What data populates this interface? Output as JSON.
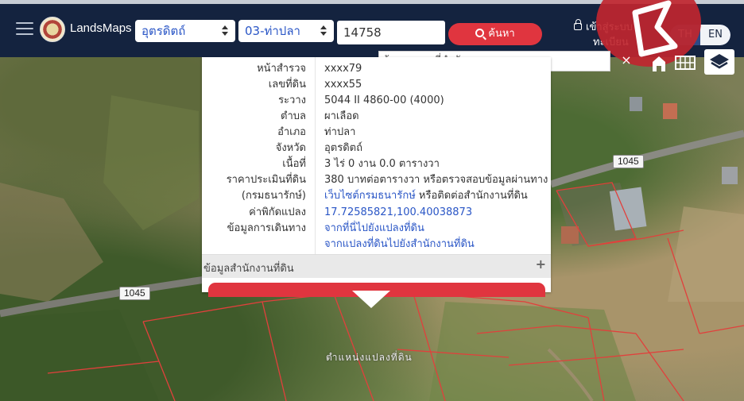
{
  "header": {
    "brand": "LandsMaps",
    "province": "อุตรดิตถ์",
    "district": "03-ท่าปลา",
    "deed_no": "14758",
    "search_label": "ค้นหา",
    "login_line1": "เข้าสู่ระบบ",
    "login_line2": "ทะเบียน",
    "lang_th": "TH",
    "lang_en": "EN"
  },
  "map": {
    "landmark_search_placeholder": "ค้นหาสถานที่สำคัญ",
    "clear": "×",
    "road_badges": [
      "1045",
      "1045"
    ],
    "parcel_label": "ตำแหน่งแปลงที่ดิน"
  },
  "popup": {
    "rows": [
      {
        "label": "หน้าสำรวจ",
        "value": "xxxx79"
      },
      {
        "label": "เลขที่ดิน",
        "value": "xxxx55"
      },
      {
        "label": "ระวาง",
        "value": "5044 II 4860-00 (4000)"
      },
      {
        "label": "ตำบล",
        "value": "ผาเลือด"
      },
      {
        "label": "อำเภอ",
        "value": "ท่าปลา"
      },
      {
        "label": "จังหวัด",
        "value": "อุตรดิตถ์"
      },
      {
        "label": "เนื้อที่",
        "value": "3 ไร่ 0 งาน 0.0 ตารางวา"
      },
      {
        "label": "ราคาประเมินที่ดิน",
        "value": "380 บาทต่อตารางวา หรือตรวจสอบข้อมูลผ่านทาง"
      },
      {
        "label": "(กรมธนารักษ์)",
        "value_link": "เว็บไซต์กรมธนารักษ์",
        "value_rest": " หรือติดต่อสำนักงานที่ดิน"
      },
      {
        "label": "ค่าพิกัดแปลง",
        "value": "17.72585821,100.40038873"
      },
      {
        "label": "ข้อมูลการเดินทาง",
        "value": "จากที่นี่ไปยังแปลงที่ดิน"
      },
      {
        "label": "",
        "value": "จากแปลงที่ดินไปยังสำนักงานที่ดิน"
      }
    ],
    "office_section": "ข้อมูลสำนักงานที่ดิน",
    "office_toggle": "+"
  },
  "colors": {
    "header_bg": "#14233f",
    "accent_red": "#e0353f",
    "link_blue": "#2a56c6"
  }
}
